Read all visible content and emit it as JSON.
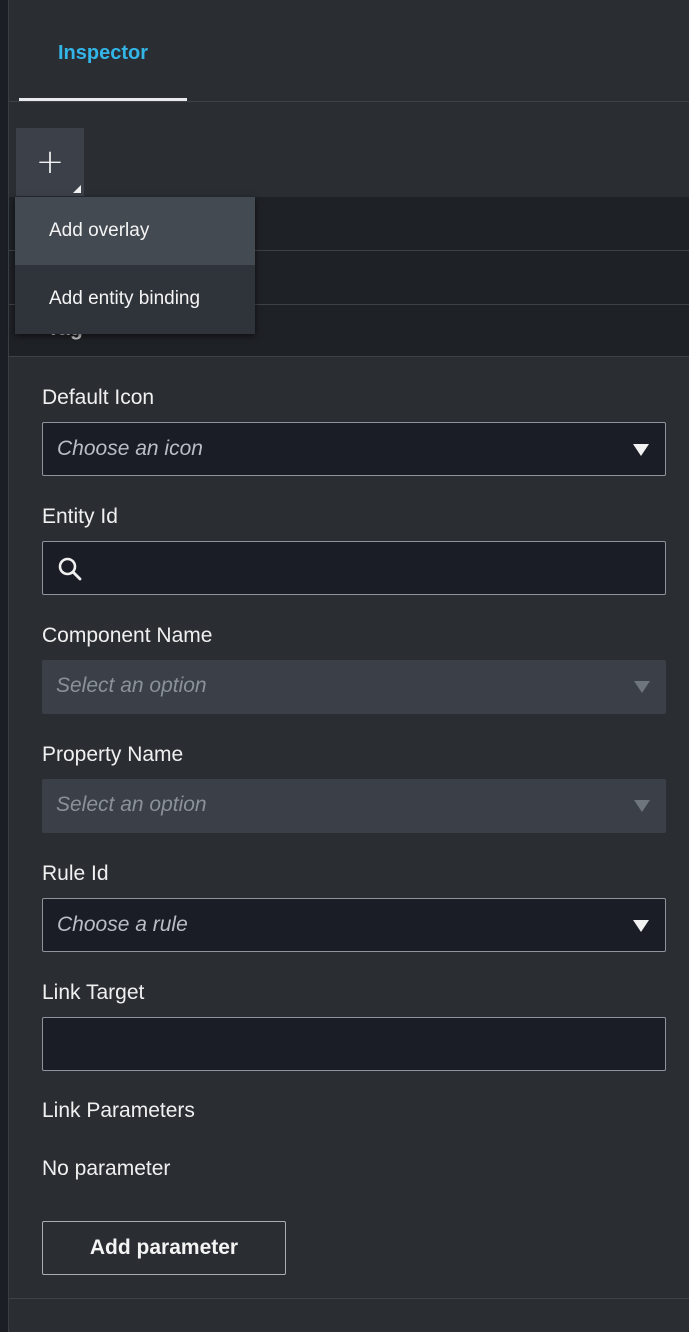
{
  "tabs": [
    {
      "label": "Inspector",
      "active": true
    }
  ],
  "toolbar": {
    "add_symbol": "+"
  },
  "menu": {
    "items": [
      {
        "label": "Add overlay",
        "highlighted": true
      },
      {
        "label": "Add entity binding",
        "highlighted": false
      }
    ]
  },
  "section": {
    "title": "Tag"
  },
  "form": {
    "default_icon": {
      "label": "Default Icon",
      "placeholder": "Choose an icon"
    },
    "entity_id": {
      "label": "Entity Id",
      "value": ""
    },
    "component_name": {
      "label": "Component Name",
      "placeholder": "Select an option",
      "disabled": true
    },
    "property_name": {
      "label": "Property Name",
      "placeholder": "Select an option",
      "disabled": true
    },
    "rule_id": {
      "label": "Rule Id",
      "placeholder": "Choose a rule"
    },
    "link_target": {
      "label": "Link Target",
      "value": ""
    },
    "link_parameters": {
      "label": "Link Parameters",
      "empty_text": "No parameter",
      "add_button": "Add parameter"
    }
  },
  "colors": {
    "accent": "#33b5e8",
    "panel_bg": "#2a2e33",
    "input_bg": "#1a1d26",
    "disabled_bg": "#3b4048"
  }
}
